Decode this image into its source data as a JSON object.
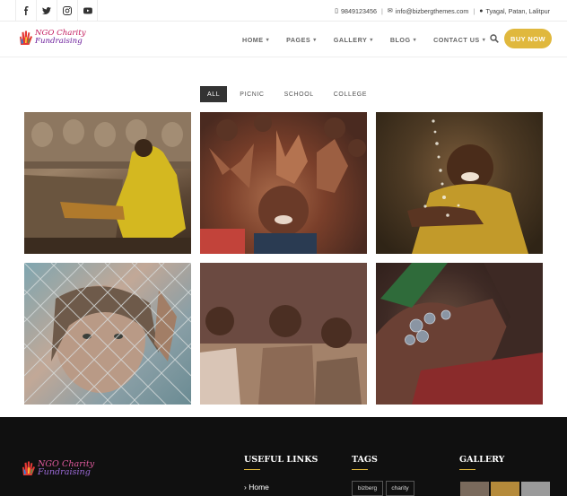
{
  "topbar": {
    "social": [
      "facebook-icon",
      "twitter-icon",
      "instagram-icon",
      "youtube-icon"
    ],
    "phone": "9849123456",
    "email": "info@bizbergthemes.com",
    "location": "Tyagal, Patan, Lalitpur",
    "separator": "|"
  },
  "header": {
    "logo_line1": "NGO Charity",
    "logo_line2": "Fundraising",
    "nav": [
      {
        "label": "HOME"
      },
      {
        "label": "PAGES"
      },
      {
        "label": "GALLERY"
      },
      {
        "label": "BLOG"
      },
      {
        "label": "CONTACT US"
      }
    ],
    "caret": "▾",
    "buy_label": "BUY NOW"
  },
  "filters": [
    {
      "label": "ALL",
      "active": true
    },
    {
      "label": "PICNIC",
      "active": false
    },
    {
      "label": "SCHOOL",
      "active": false
    },
    {
      "label": "COLLEGE",
      "active": false
    }
  ],
  "gallery": [
    {
      "subject": "elderly person in yellow"
    },
    {
      "subject": "children raising hands"
    },
    {
      "subject": "child with water splash"
    },
    {
      "subject": "girl behind wire fence"
    },
    {
      "subject": "children at wall"
    },
    {
      "subject": "hands holding coins"
    }
  ],
  "footer": {
    "logo_line1": "NGO Charity",
    "logo_line2": "Fundraising",
    "useful_links_title": "USEFUL LINKS",
    "tags_title": "TAGS",
    "gallery_title": "GALLERY",
    "first_link": "Home",
    "link_chevron": "›",
    "tags": [
      "bizberg",
      "charity"
    ]
  },
  "colors": {
    "accent": "#e0b83d",
    "footer_bg": "#101010",
    "active_filter_bg": "#333333"
  }
}
